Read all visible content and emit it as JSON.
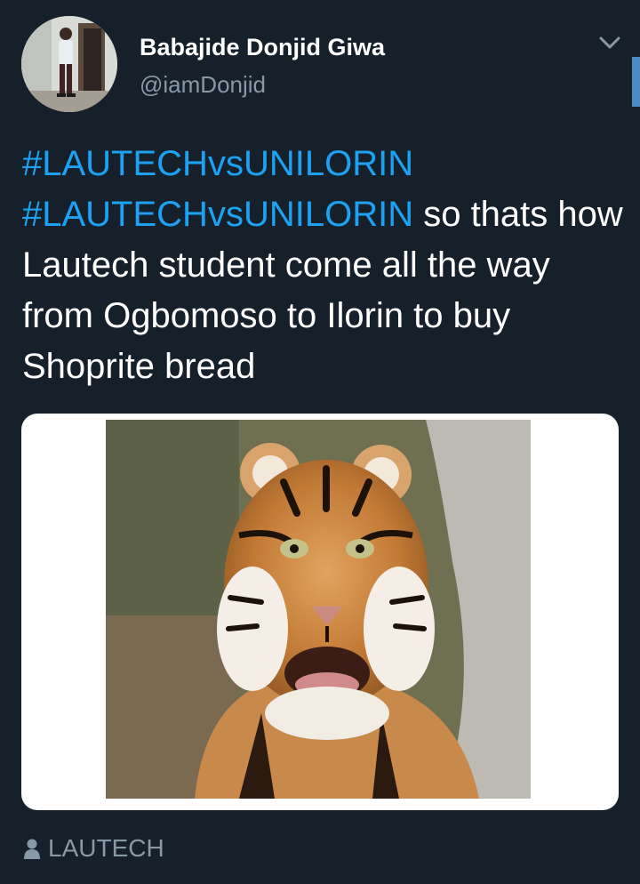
{
  "tweet": {
    "author_name": "Babajide Donjid Giwa",
    "author_handle": "@iamDonjid",
    "hashtag_1": "#LAUTECHvsUNILORIN",
    "hashtag_2": "#LAUTECHvsUNILORIN",
    "text": "so thats how Lautech student come all the way from Ogbomoso to Ilorin to buy Shoprite bread",
    "location": "LAUTECH"
  },
  "icons": {
    "menu": "chevron-down-icon",
    "location": "person-icon"
  },
  "colors": {
    "background": "#15202b",
    "hashtag": "#1da1f2",
    "secondary_text": "#8899a6",
    "primary_text": "#ffffff"
  }
}
